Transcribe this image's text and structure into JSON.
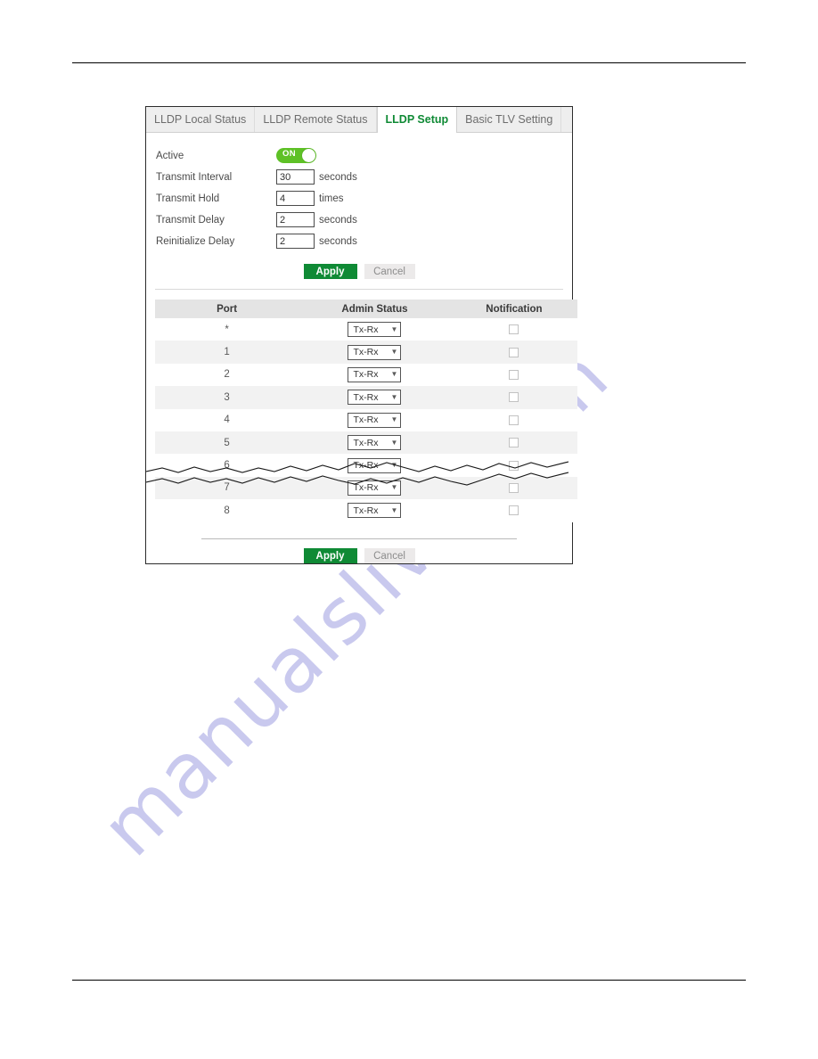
{
  "panel": {
    "tabs": [
      {
        "label": "LLDP Local Status",
        "active": false
      },
      {
        "label": "LLDP Remote Status",
        "active": false
      },
      {
        "label": "LLDP Setup",
        "active": true
      },
      {
        "label": "Basic TLV Setting",
        "active": false
      }
    ],
    "form": {
      "active_label": "Active",
      "active_toggle_state": "ON",
      "fields": [
        {
          "label": "Transmit Interval",
          "value": "30",
          "unit": "seconds"
        },
        {
          "label": "Transmit Hold",
          "value": "4",
          "unit": "times"
        },
        {
          "label": "Transmit Delay",
          "value": "2",
          "unit": "seconds"
        },
        {
          "label": "Reinitialize Delay",
          "value": "2",
          "unit": "seconds"
        }
      ]
    },
    "buttons_top": {
      "apply": "Apply",
      "cancel": "Cancel"
    },
    "table": {
      "headers": [
        "Port",
        "Admin Status",
        "Notification"
      ],
      "admin_status_options": [
        "Tx-Rx"
      ],
      "rows": [
        {
          "port": "*",
          "admin_status": "Tx-Rx",
          "notification": false
        },
        {
          "port": "1",
          "admin_status": "Tx-Rx",
          "notification": false
        },
        {
          "port": "2",
          "admin_status": "Tx-Rx",
          "notification": false
        },
        {
          "port": "3",
          "admin_status": "Tx-Rx",
          "notification": false
        },
        {
          "port": "4",
          "admin_status": "Tx-Rx",
          "notification": false
        },
        {
          "port": "5",
          "admin_status": "Tx-Rx",
          "notification": false
        },
        {
          "port": "6",
          "admin_status": "Tx-Rx",
          "notification": false
        },
        {
          "port": "7",
          "admin_status": "Tx-Rx",
          "notification": false
        },
        {
          "port": "8",
          "admin_status": "Tx-Rx",
          "notification": false
        }
      ]
    },
    "buttons_bottom": {
      "apply": "Apply",
      "cancel": "Cancel"
    }
  },
  "watermark": {
    "text": "manualslive.com"
  },
  "colors": {
    "accent_green": "#0f8a35",
    "toggle_green": "#5ec126",
    "tabbar_gray": "#eeeeee",
    "header_gray": "#e4e4e4",
    "row_alt_gray": "#f2f2f2",
    "watermark": "#c9c9ee"
  }
}
